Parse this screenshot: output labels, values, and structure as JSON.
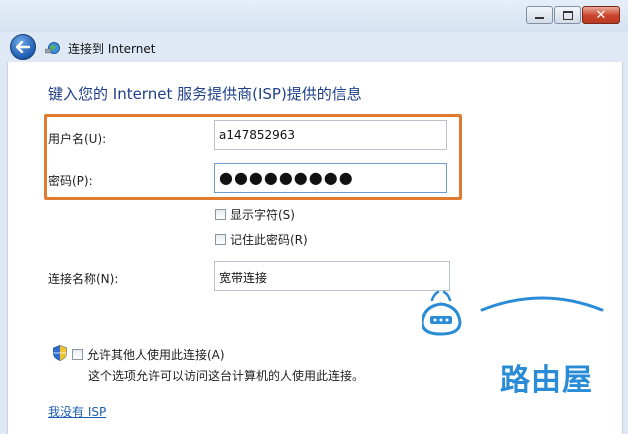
{
  "window": {
    "close_glyph": "✕"
  },
  "nav": {
    "title": "连接到 Internet"
  },
  "form": {
    "heading": "键入您的 Internet 服务提供商(ISP)提供的信息",
    "username_label": "用户名(U):",
    "username_value": "a147852963",
    "password_label": "密码(P):",
    "password_value": "●●●●●●●●●",
    "show_chars_label": "显示字符(S)",
    "remember_label": "记住此密码(R)",
    "connection_name_label": "连接名称(N):",
    "connection_name_value": "宽带连接",
    "allow_others_label": "允许其他人使用此连接(A)",
    "allow_others_note": "这个选项允许可以访问这台计算机的人使用此连接。",
    "no_isp_link": "我没有 ISP"
  },
  "watermark": {
    "text": "路由屋"
  },
  "colors": {
    "highlight": "#e07a2e",
    "heading": "#1f3f8a",
    "link": "#1a5fb4",
    "logo": "#2a8bd6"
  }
}
